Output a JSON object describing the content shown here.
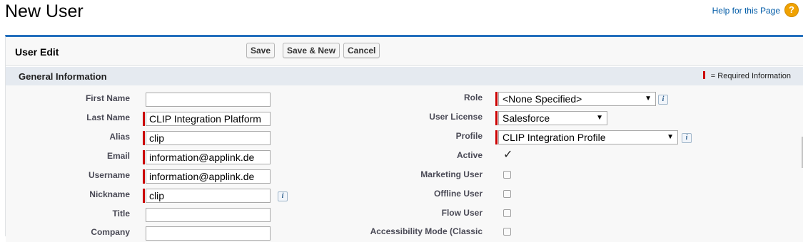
{
  "page": {
    "title": "New User",
    "help_link": "Help for this Page",
    "help_icon": "?"
  },
  "panel": {
    "title": "User Edit",
    "buttons": {
      "save": "Save",
      "save_new": "Save & New",
      "cancel": "Cancel"
    }
  },
  "section": {
    "title": "General Information",
    "required_legend": "= Required Information"
  },
  "left_fields": {
    "first_name": {
      "label": "First Name",
      "value": ""
    },
    "last_name": {
      "label": "Last Name",
      "value": "CLIP Integration Platform"
    },
    "alias": {
      "label": "Alias",
      "value": "clip"
    },
    "email": {
      "label": "Email",
      "value": "information@applink.de"
    },
    "username": {
      "label": "Username",
      "value": "information@applink.de"
    },
    "nickname": {
      "label": "Nickname",
      "value": "clip"
    },
    "title": {
      "label": "Title",
      "value": ""
    },
    "company": {
      "label": "Company",
      "value": ""
    }
  },
  "right_fields": {
    "role": {
      "label": "Role",
      "value": "<None Specified>"
    },
    "user_license": {
      "label": "User License",
      "value": "Salesforce"
    },
    "profile": {
      "label": "Profile",
      "value": "CLIP Integration Profile"
    },
    "active": {
      "label": "Active",
      "checked": true
    },
    "marketing_user": {
      "label": "Marketing User",
      "checked": false
    },
    "offline_user": {
      "label": "Offline User",
      "checked": false
    },
    "flow_user": {
      "label": "Flow User",
      "checked": false
    },
    "accessibility_mode": {
      "label": "Accessibility Mode (Classic",
      "checked": false
    }
  },
  "icons": {
    "info": "i",
    "checkmark": "✓",
    "dropdown": "▼"
  },
  "colors": {
    "accent": "#236fbd",
    "required": "#cc0000",
    "link": "#015ba7",
    "section_bg": "#e5eaf0"
  }
}
